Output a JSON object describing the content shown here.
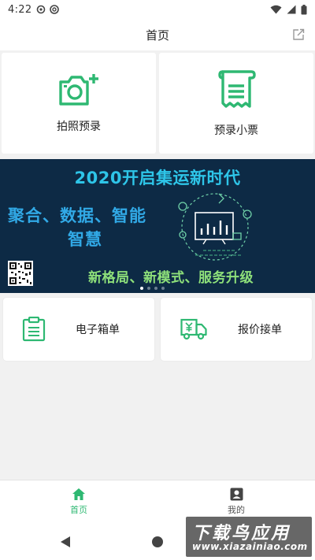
{
  "status_bar": {
    "time": "4:22",
    "left_icons": [
      "settings-icon",
      "at-sign-icon"
    ],
    "right_icons": [
      "wifi-icon",
      "signal-icon",
      "battery-icon"
    ]
  },
  "header": {
    "title": "首页",
    "share_icon": "share-icon"
  },
  "top_cards": [
    {
      "label": "拍照预录",
      "icon": "camera-plus-icon"
    },
    {
      "label": "预录小票",
      "icon": "receipt-icon"
    }
  ],
  "banner": {
    "title": "2020开启集运新时代",
    "line1": "聚合、数据、智能",
    "line2": "智慧",
    "bottom": "新格局、新模式、服务升级",
    "dot_count": 4,
    "active_dot": 0
  },
  "actions": [
    {
      "label": "电子箱单",
      "icon": "clipboard-icon"
    },
    {
      "label": "报价接单",
      "icon": "delivery-truck-icon"
    }
  ],
  "bottom_nav": {
    "items": [
      {
        "label": "首页",
        "icon": "home-icon",
        "active": true
      },
      {
        "label": "我的",
        "icon": "user-icon",
        "active": false
      }
    ]
  },
  "watermark": {
    "title": "下载鸟应用",
    "url": "www.xiazainiao.com"
  },
  "colors": {
    "accent": "#2eb872",
    "banner_bg": "#0d2a45",
    "banner_title": "#2ec5e8",
    "banner_text": "#31a9e6",
    "banner_bottom": "#8ee07a"
  }
}
